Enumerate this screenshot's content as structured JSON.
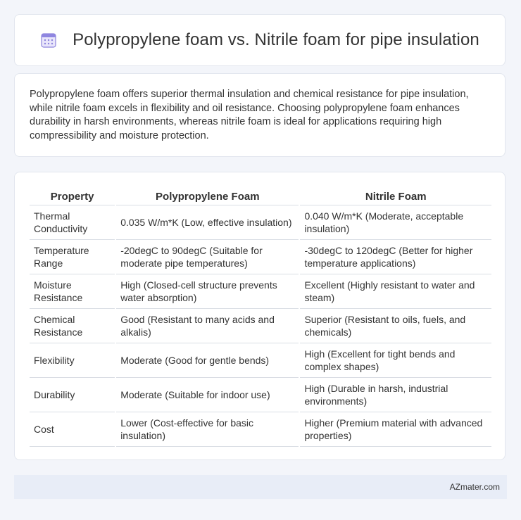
{
  "header": {
    "icon": "calendar-icon",
    "title": "Polypropylene foam vs. Nitrile foam for pipe insulation"
  },
  "intro": {
    "text": "Polypropylene foam offers superior thermal insulation and chemical resistance for pipe insulation, while nitrile foam excels in flexibility and oil resistance. Choosing polypropylene foam enhances durability in harsh environments, whereas nitrile foam is ideal for applications requiring high compressibility and moisture protection."
  },
  "table": {
    "headers": [
      "Property",
      "Polypropylene Foam",
      "Nitrile Foam"
    ],
    "rows": [
      [
        "Thermal Conductivity",
        "0.035 W/m*K (Low, effective insulation)",
        "0.040 W/m*K (Moderate, acceptable insulation)"
      ],
      [
        "Temperature Range",
        "-20degC to 90degC (Suitable for moderate pipe temperatures)",
        "-30degC to 120degC (Better for higher temperature applications)"
      ],
      [
        "Moisture Resistance",
        "High (Closed-cell structure prevents water absorption)",
        "Excellent (Highly resistant to water and steam)"
      ],
      [
        "Chemical Resistance",
        "Good (Resistant to many acids and alkalis)",
        "Superior (Resistant to oils, fuels, and chemicals)"
      ],
      [
        "Flexibility",
        "Moderate (Good for gentle bends)",
        "High (Excellent for tight bends and complex shapes)"
      ],
      [
        "Durability",
        "Moderate (Suitable for indoor use)",
        "High (Durable in harsh, industrial environments)"
      ],
      [
        "Cost",
        "Lower (Cost-effective for basic insulation)",
        "Higher (Premium material with advanced properties)"
      ]
    ]
  },
  "footer": {
    "brand": "AZmater.com"
  },
  "colors": {
    "background": "#f3f5fa",
    "card": "#ffffff",
    "footer": "#e8edf7",
    "icon_accent": "#7b6fd6"
  }
}
